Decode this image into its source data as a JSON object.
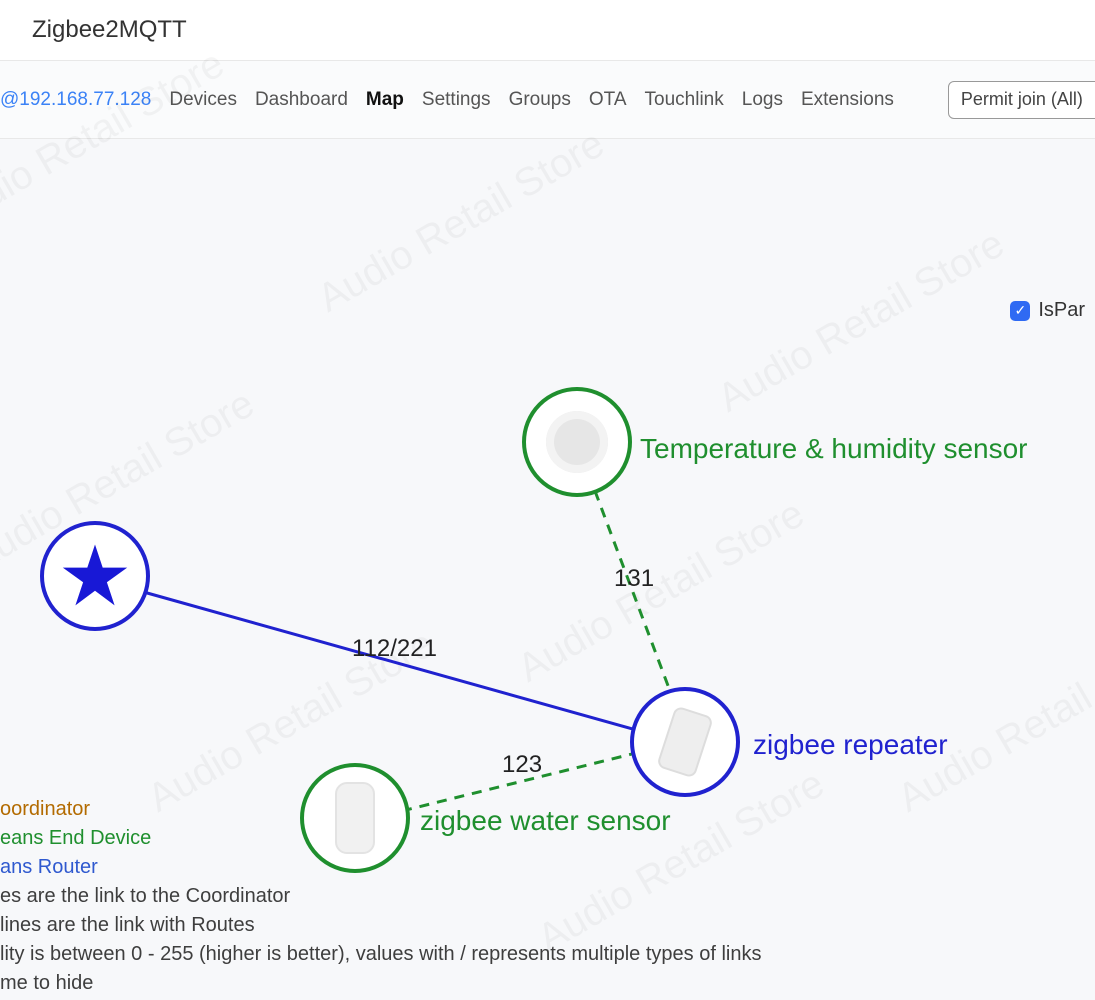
{
  "header": {
    "title": "Zigbee2MQTT"
  },
  "nav": {
    "host": "@192.168.77.128",
    "items": [
      "Devices",
      "Dashboard",
      "Map",
      "Settings",
      "Groups",
      "OTA",
      "Touchlink",
      "Logs",
      "Extensions"
    ],
    "active_index": 2,
    "permit_join": "Permit join (All)"
  },
  "checkbox": {
    "label": "IsPar",
    "checked": true
  },
  "nodes": {
    "coordinator": {
      "label": ""
    },
    "temp_humidity": {
      "label": "Temperature & humidity sensor"
    },
    "repeater": {
      "label": "zigbee repeater"
    },
    "water_sensor": {
      "label": "zigbee water sensor"
    }
  },
  "edges": {
    "coord_repeater": {
      "label": "112/221"
    },
    "temp_repeater": {
      "label": "131"
    },
    "water_repeater": {
      "label": "123"
    }
  },
  "legend": {
    "coordinator": "oordinator",
    "enddevice": "eans End Device",
    "router": "ans Router",
    "line1": "es are the link to the Coordinator",
    "line2": "lines are the link with Routes",
    "line3": "lity is between 0 - 255 (higher is better), values with / represents multiple types of links",
    "line4": "me to hide"
  },
  "watermark": "Audio Retail Store"
}
